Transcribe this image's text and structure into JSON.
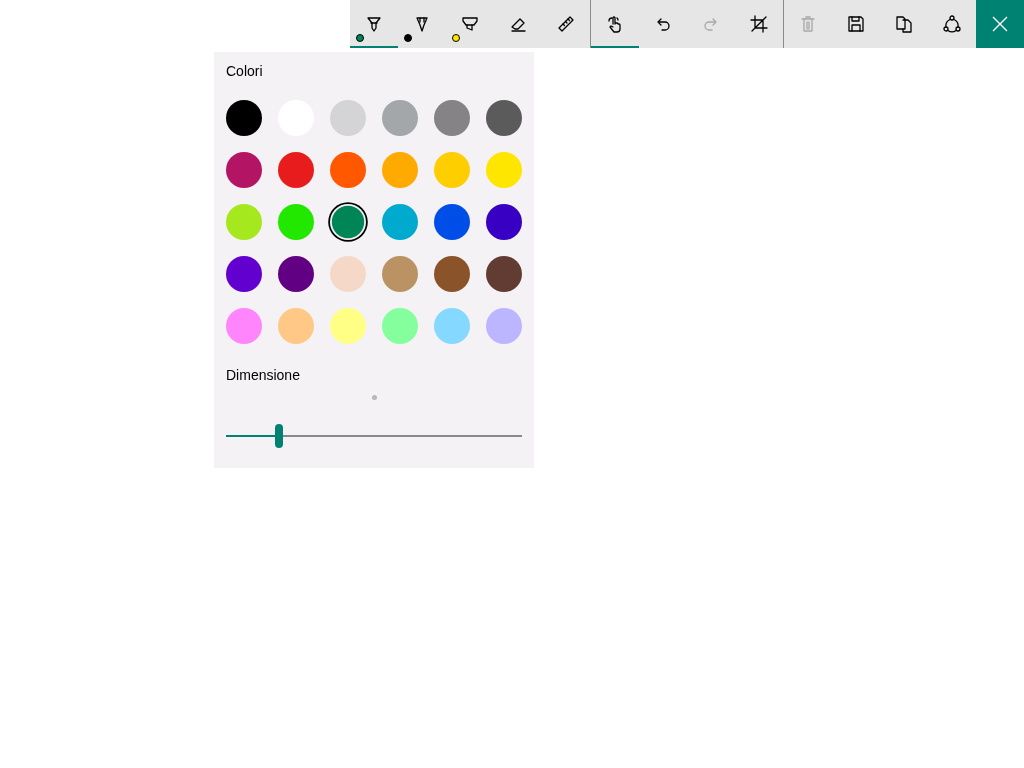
{
  "toolbar": {
    "groups": [
      {
        "tools": [
          {
            "kind": "ballpoint",
            "selected": true,
            "disabled": false,
            "color": "#00845a"
          },
          {
            "kind": "pencil",
            "selected": false,
            "disabled": false,
            "color": "#000000"
          },
          {
            "kind": "highlighter",
            "selected": false,
            "disabled": false,
            "color": "#ffe600"
          },
          {
            "kind": "eraser",
            "selected": false,
            "disabled": false
          },
          {
            "kind": "ruler",
            "selected": false,
            "disabled": false
          }
        ]
      },
      {
        "tools": [
          {
            "kind": "touch",
            "selected": true,
            "disabled": false
          },
          {
            "kind": "undo",
            "selected": false,
            "disabled": false
          },
          {
            "kind": "redo",
            "selected": false,
            "disabled": true
          },
          {
            "kind": "crop",
            "selected": false,
            "disabled": false
          }
        ]
      },
      {
        "tools": [
          {
            "kind": "delete",
            "selected": false,
            "disabled": true
          },
          {
            "kind": "save",
            "selected": false,
            "disabled": false
          },
          {
            "kind": "copy",
            "selected": false,
            "disabled": false
          },
          {
            "kind": "share",
            "selected": false,
            "disabled": false
          }
        ]
      }
    ],
    "close": {
      "kind": "close"
    }
  },
  "palette": {
    "title": "Colori",
    "swatches": [
      {
        "color": "#000000",
        "selected": false
      },
      {
        "color": "#ffffff",
        "selected": false
      },
      {
        "color": "#d4d4d6",
        "selected": false
      },
      {
        "color": "#a3a7a9",
        "selected": false
      },
      {
        "color": "#858385",
        "selected": false
      },
      {
        "color": "#5b5b5b",
        "selected": false
      },
      {
        "color": "#b31564",
        "selected": false
      },
      {
        "color": "#e81c1c",
        "selected": false
      },
      {
        "color": "#ff5800",
        "selected": false
      },
      {
        "color": "#ffaa00",
        "selected": false
      },
      {
        "color": "#ffce00",
        "selected": false
      },
      {
        "color": "#ffe600",
        "selected": false
      },
      {
        "color": "#a5e81e",
        "selected": false
      },
      {
        "color": "#22e800",
        "selected": false
      },
      {
        "color": "#008656",
        "selected": true
      },
      {
        "color": "#00aace",
        "selected": false
      },
      {
        "color": "#004ee8",
        "selected": false
      },
      {
        "color": "#3700c3",
        "selected": false
      },
      {
        "color": "#6100cf",
        "selected": false
      },
      {
        "color": "#610082",
        "selected": false
      },
      {
        "color": "#f6d8c8",
        "selected": false
      },
      {
        "color": "#bb9264",
        "selected": false
      },
      {
        "color": "#8b532a",
        "selected": false
      },
      {
        "color": "#623c32",
        "selected": false
      },
      {
        "color": "#ff85fd",
        "selected": false
      },
      {
        "color": "#ffc886",
        "selected": false
      },
      {
        "color": "#ffff85",
        "selected": false
      },
      {
        "color": "#85ff9e",
        "selected": false
      },
      {
        "color": "#85d8ff",
        "selected": false
      },
      {
        "color": "#bcb5ff",
        "selected": false
      }
    ],
    "size": {
      "label": "Dimensione",
      "level": 0.18
    }
  }
}
